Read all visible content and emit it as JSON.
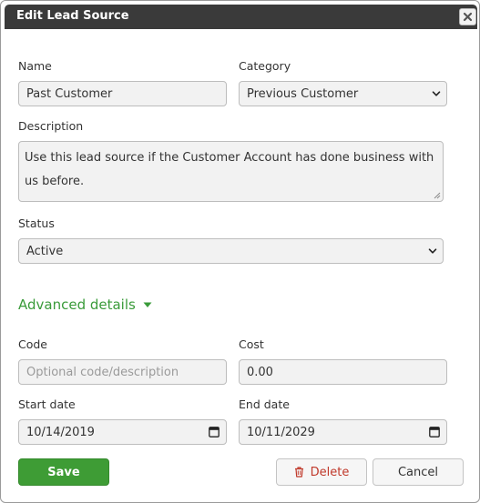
{
  "dialog": {
    "title": "Edit Lead Source",
    "close_icon": "close-icon"
  },
  "form": {
    "name": {
      "label": "Name",
      "value": "Past Customer"
    },
    "category": {
      "label": "Category",
      "value": "Previous Customer"
    },
    "description": {
      "label": "Description",
      "line1": "Use this lead source if the Customer Account has done business with",
      "line2": "us before."
    },
    "status": {
      "label": "Status",
      "value": "Active"
    },
    "advanced_toggle": "Advanced details",
    "code": {
      "label": "Code",
      "placeholder": "Optional code/description",
      "value": ""
    },
    "cost": {
      "label": "Cost",
      "value": "0.00"
    },
    "start_date": {
      "label": "Start date",
      "value": "10/14/2019"
    },
    "end_date": {
      "label": "End date",
      "value": "10/11/2029"
    }
  },
  "actions": {
    "save_label": "Save",
    "delete_label": "Delete",
    "cancel_label": "Cancel"
  },
  "colors": {
    "titlebar": "#3a3a3a",
    "accent_green": "#3e9c35",
    "link_green": "#3a9b3a",
    "delete_red": "#c0392b",
    "field_bg": "#f2f2f2"
  },
  "icons": [
    "close-icon",
    "chevron-down-icon",
    "caret-down-icon",
    "calendar-icon",
    "trash-icon",
    "resize-grip-icon"
  ]
}
